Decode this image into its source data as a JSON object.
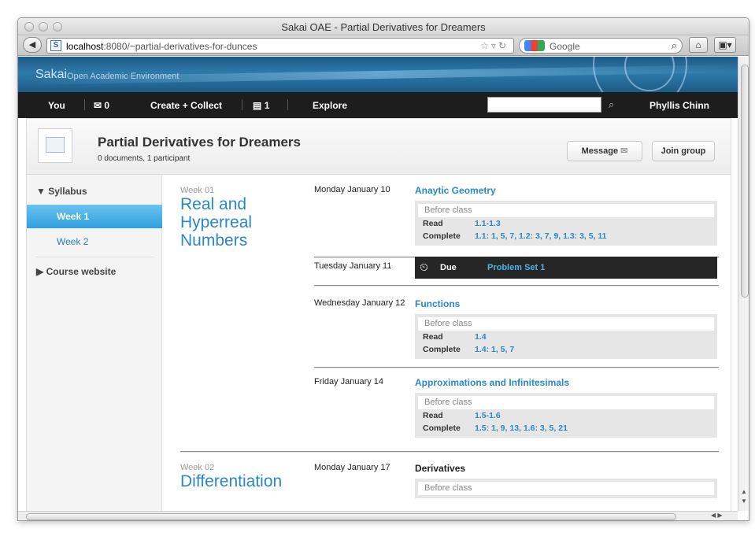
{
  "browser": {
    "window_title": "Sakai OAE - Partial Derivatives for Dreamers",
    "url_host": "localhost",
    "url_rest": ":8080/~partial-derivatives-for-dunces",
    "site_icon_letter": "S",
    "search_engine": "Google"
  },
  "banner": {
    "brand": "Sakai",
    "brand_subtitle": "Open Academic Environment"
  },
  "topnav": {
    "you": "You",
    "messages_count": "0",
    "create_collect": "Create + Collect",
    "inbox_count": "1",
    "explore": "Explore",
    "search_value": "",
    "user_name": "Phyllis Chinn"
  },
  "group": {
    "title": "Partial Derivatives for Dreamers",
    "meta": "0 documents, 1 participant",
    "message_label": "Message",
    "join_label": "Join group"
  },
  "sidebar": {
    "syllabus": "Syllabus",
    "items": [
      {
        "label": "Week 1",
        "active": true
      },
      {
        "label": "Week 2",
        "active": false
      }
    ],
    "course_website": "Course website"
  },
  "weeks": [
    {
      "label": "Week 01",
      "title": "Real and Hyperreal Numbers"
    },
    {
      "label": "Week 02",
      "title": "Differentiation"
    }
  ],
  "days": [
    {
      "date": "Monday January 10",
      "topic": "Anaytic Geometry",
      "before": "Before class",
      "read_label": "Read",
      "read": "1.1-1.3",
      "complete_label": "Complete",
      "complete": "1.1: 1, 5, 7, 1.2: 3, 7, 9, 1.3: 3, 5, 11"
    },
    {
      "date": "Tuesday January 11",
      "due_label": "Due",
      "due_item": "Problem Set 1"
    },
    {
      "date": "Wednesday January 12",
      "topic": "Functions",
      "before": "Before class",
      "read_label": "Read",
      "read": "1.4",
      "complete_label": "Complete",
      "complete": "1.4: 1, 5, 7"
    },
    {
      "date": "Friday January 14",
      "topic": "Approximations and Infinitesimals",
      "before": "Before class",
      "read_label": "Read",
      "read": "1.5-1.6",
      "complete_label": "Complete",
      "complete": "1.5: 1, 9, 13, 1.6: 3, 5, 21"
    },
    {
      "date": "Monday January 17",
      "topic": "Derivatives",
      "before": "Before class"
    }
  ],
  "colors": {
    "accent": "#2b88c6",
    "active_nav": "#2fa0dd",
    "topnav_bg": "#1d1d1d",
    "banner_bg": "#1f5a86"
  }
}
